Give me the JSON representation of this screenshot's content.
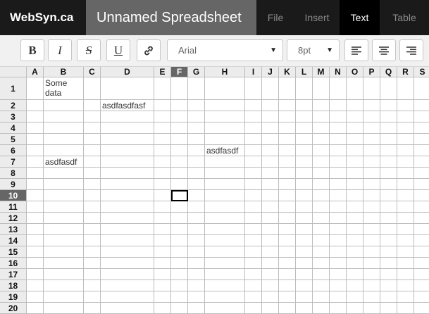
{
  "app": {
    "brand": "WebSyn.ca",
    "title": "Unnamed Spreadsheet"
  },
  "menu": [
    {
      "label": "File",
      "active": false
    },
    {
      "label": "Insert",
      "active": false
    },
    {
      "label": "Text",
      "active": true
    },
    {
      "label": "Table",
      "active": false
    }
  ],
  "toolbar": {
    "bold": "B",
    "italic": "I",
    "strike": "S",
    "underline": "U",
    "font": "Arial",
    "size": "8pt"
  },
  "columns": [
    "A",
    "B",
    "C",
    "D",
    "E",
    "F",
    "G",
    "H",
    "I",
    "J",
    "K",
    "L",
    "M",
    "N",
    "O",
    "P",
    "Q",
    "R",
    "S"
  ],
  "rows": [
    "1",
    "2",
    "3",
    "4",
    "5",
    "6",
    "7",
    "8",
    "9",
    "10",
    "11",
    "12",
    "13",
    "14",
    "15",
    "16",
    "17",
    "18",
    "19",
    "20"
  ],
  "selected": {
    "col": "F",
    "row": "10"
  },
  "cells": {
    "B1": "Some data",
    "D2": "asdfasdfasf",
    "H6": "asdfasdf",
    "B7": "asdfasdf"
  }
}
